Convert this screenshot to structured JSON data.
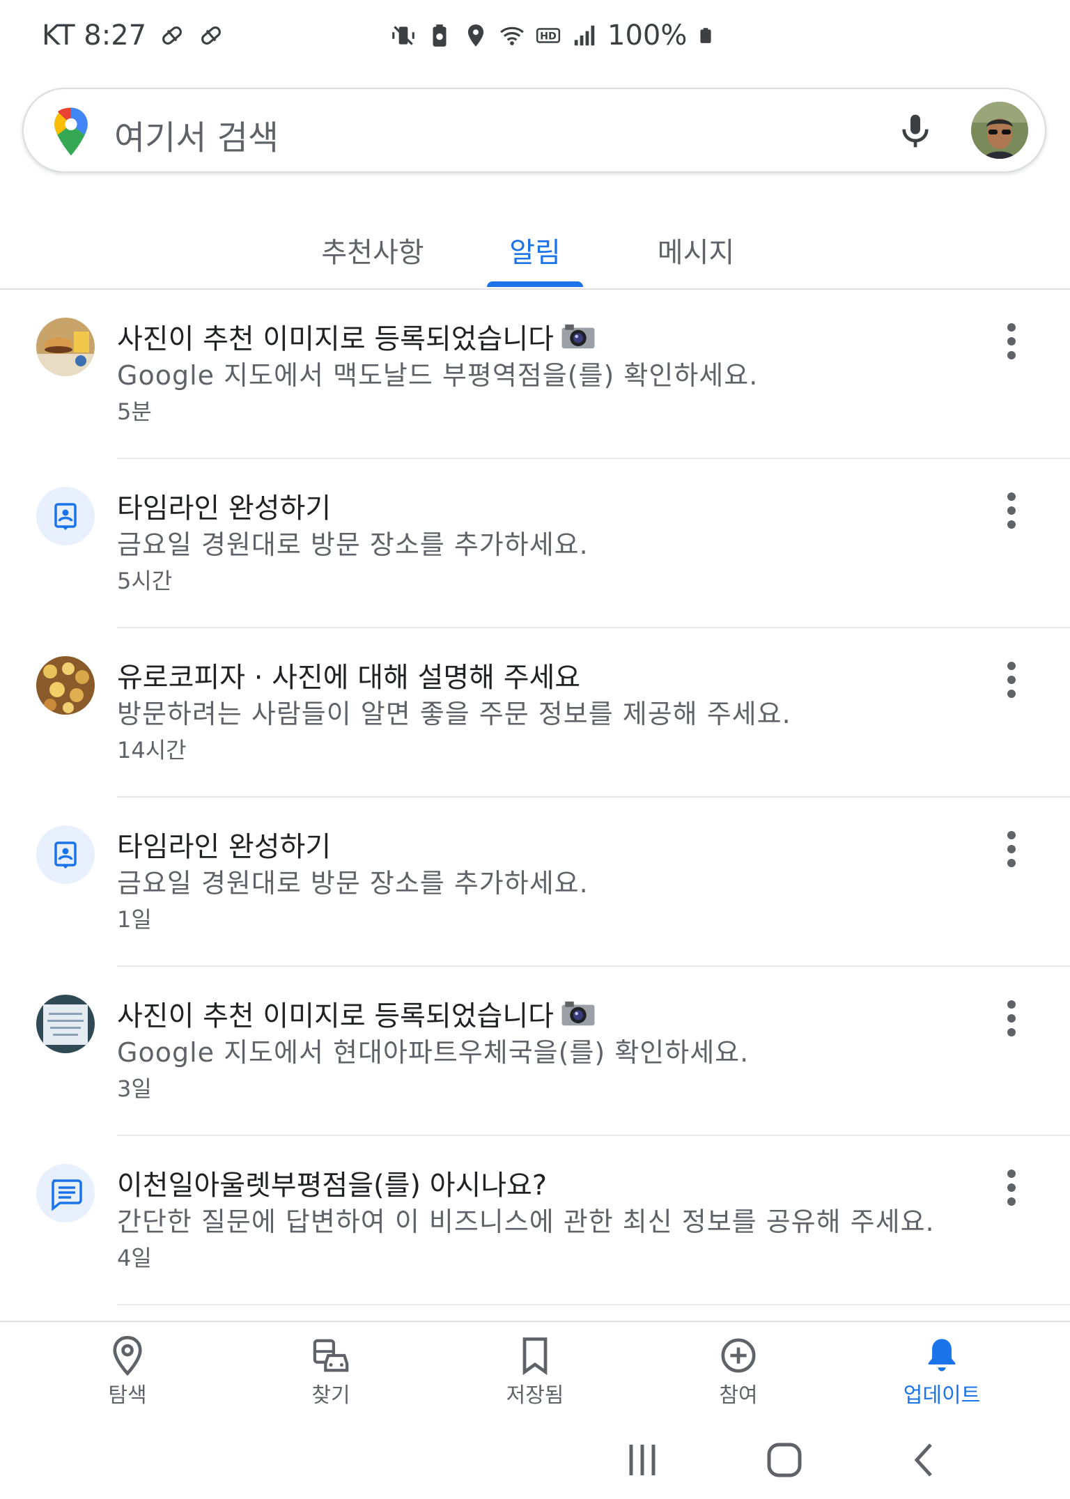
{
  "status_bar": {
    "carrier_time": "KT 8:27",
    "battery": "100%",
    "icons": [
      "pill-icon",
      "pill-icon",
      "mute-vibrate-icon",
      "battery-saver-icon",
      "location-icon",
      "wifi-icon",
      "hd-icon",
      "signal-icon",
      "battery-icon"
    ]
  },
  "search": {
    "placeholder": "여기서 검색",
    "icons": [
      "google-maps-pin-icon",
      "microphone-icon",
      "profile-avatar"
    ]
  },
  "tabs": [
    {
      "label": "추천사항",
      "active": false
    },
    {
      "label": "알림",
      "active": true
    },
    {
      "label": "메시지",
      "active": false
    }
  ],
  "notifications": [
    {
      "icon": "photo-thumbnail-burger",
      "title": "사진이 추천 이미지로 등록되었습니다",
      "title_emoji": "camera-icon",
      "body": "Google 지도에서 맥도날드 부평역점을(를) 확인하세요.",
      "time": "5분"
    },
    {
      "icon": "timeline-icon",
      "title": "타임라인 완성하기",
      "body": "금요일 경원대로 방문 장소를 추가하세요.",
      "time": "5시간"
    },
    {
      "icon": "photo-thumbnail-pastry",
      "title": "유로코피자 · 사진에 대해 설명해 주세요",
      "body": "방문하려는 사람들이 알면 좋을 주문 정보를 제공해 주세요.",
      "time": "14시간"
    },
    {
      "icon": "timeline-icon",
      "title": "타임라인 완성하기",
      "body": "금요일 경원대로 방문 장소를 추가하세요.",
      "time": "1일"
    },
    {
      "icon": "photo-thumbnail-notice",
      "title": "사진이 추천 이미지로 등록되었습니다",
      "title_emoji": "camera-icon",
      "body": "Google 지도에서 현대아파트우체국을(를) 확인하세요.",
      "time": "3일"
    },
    {
      "icon": "message-icon",
      "title": "이천일아울렛부평점을(를) 아시나요?",
      "body": "간단한 질문에 답변하여 이 비즈니스에 관한 최신 정보를 공유해 주세요.",
      "time": "4일"
    }
  ],
  "bottom_nav": [
    {
      "label": "탐색",
      "icon": "location-pin-icon",
      "active": false
    },
    {
      "label": "찾기",
      "icon": "commute-icon",
      "active": false
    },
    {
      "label": "저장됨",
      "icon": "bookmark-icon",
      "active": false
    },
    {
      "label": "참여",
      "icon": "add-circle-icon",
      "active": false
    },
    {
      "label": "업데이트",
      "icon": "bell-icon",
      "active": true
    }
  ],
  "system_nav": [
    "recent-apps-icon",
    "home-icon",
    "back-icon"
  ],
  "colors": {
    "accent": "#1a73e8",
    "text_primary": "#202124",
    "text_secondary": "#5f6368",
    "icon_bg": "#e8f0fe"
  }
}
